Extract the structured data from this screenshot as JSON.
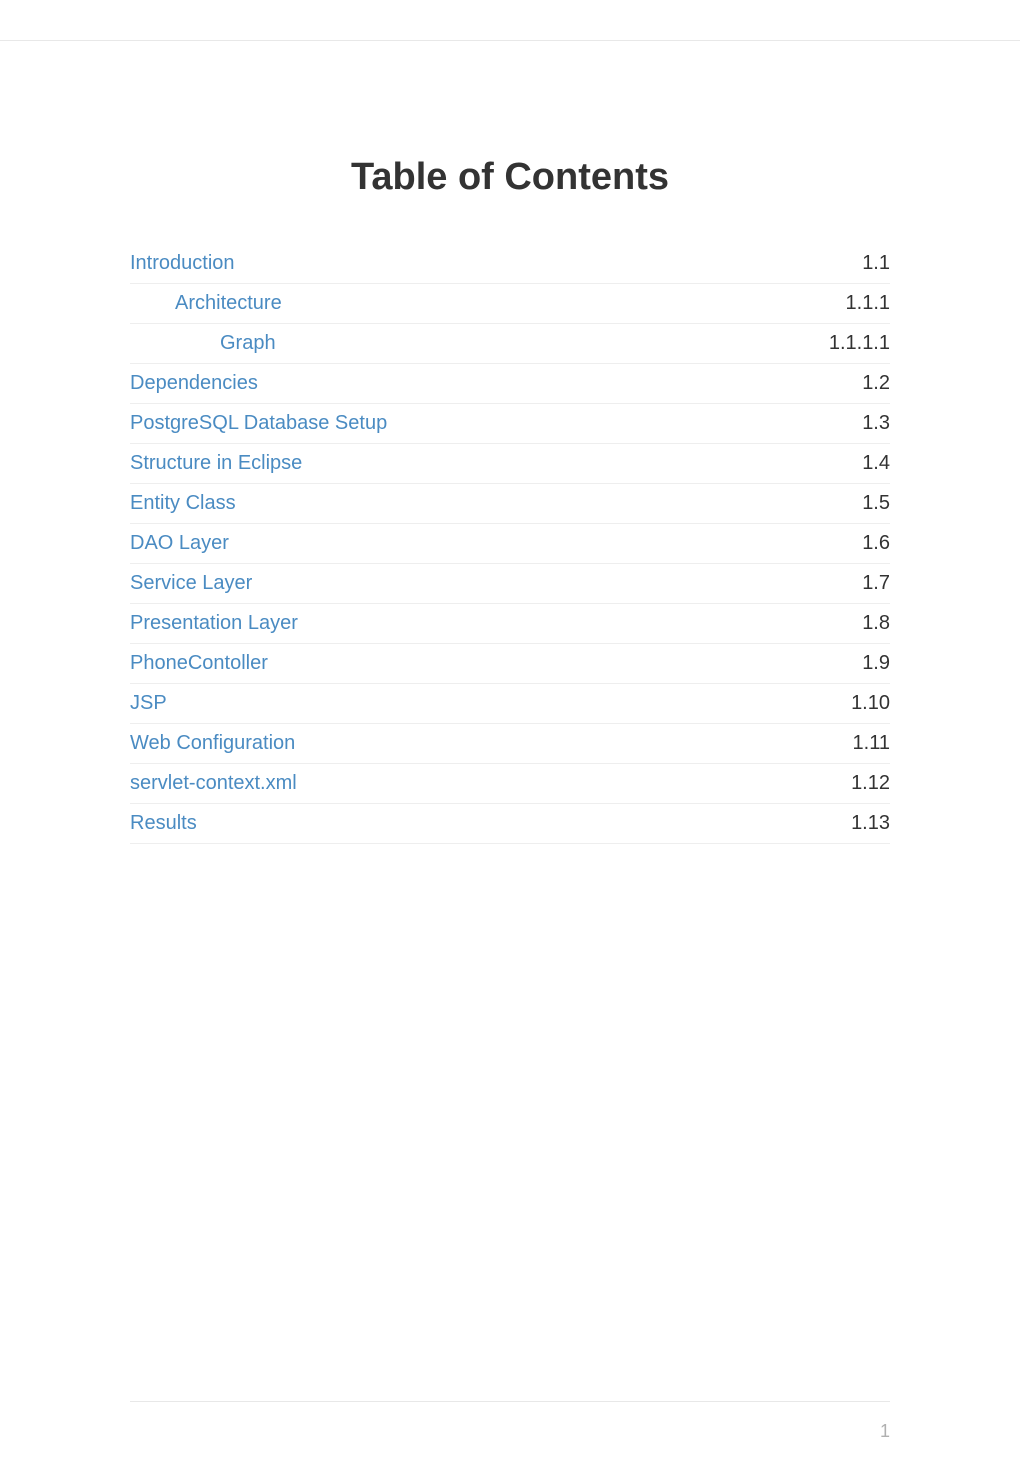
{
  "title": "Table of Contents",
  "toc": [
    {
      "label": "Introduction",
      "number": "1.1",
      "level": 0
    },
    {
      "label": "Architecture",
      "number": "1.1.1",
      "level": 1
    },
    {
      "label": "Graph",
      "number": "1.1.1.1",
      "level": 2
    },
    {
      "label": "Dependencies",
      "number": "1.2",
      "level": 0
    },
    {
      "label": "PostgreSQL Database Setup",
      "number": "1.3",
      "level": 0
    },
    {
      "label": "Structure in Eclipse",
      "number": "1.4",
      "level": 0
    },
    {
      "label": "Entity Class",
      "number": "1.5",
      "level": 0
    },
    {
      "label": "DAO Layer",
      "number": "1.6",
      "level": 0
    },
    {
      "label": "Service Layer",
      "number": "1.7",
      "level": 0
    },
    {
      "label": "Presentation Layer",
      "number": "1.8",
      "level": 0
    },
    {
      "label": "PhoneContoller",
      "number": "1.9",
      "level": 0
    },
    {
      "label": "JSP",
      "number": "1.10",
      "level": 0
    },
    {
      "label": "Web Configuration",
      "number": "1.11",
      "level": 0
    },
    {
      "label": "servlet-context.xml",
      "number": "1.12",
      "level": 0
    },
    {
      "label": "Results",
      "number": "1.13",
      "level": 0
    }
  ],
  "page_number": "1"
}
